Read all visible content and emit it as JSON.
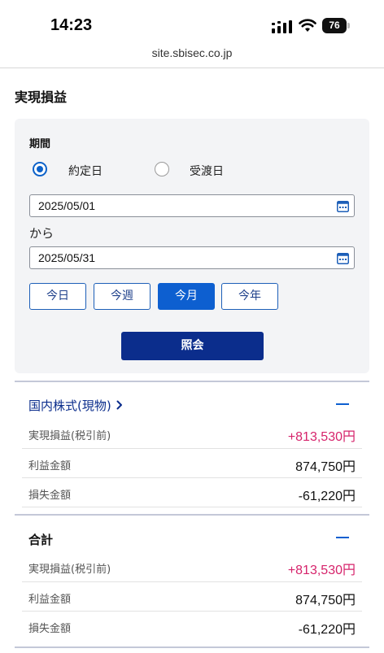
{
  "status_bar": {
    "time": "14:23",
    "battery": "76"
  },
  "browser": {
    "url": "site.sbisec.co.jp"
  },
  "page": {
    "title": "実現損益"
  },
  "filter": {
    "period_label": "期間",
    "radio_trade_date": "約定日",
    "radio_settlement_date": "受渡日",
    "selected_radio": "約定日",
    "date_from": "2025/05/01",
    "kara": "から",
    "date_to": "2025/05/31",
    "quick_buttons": [
      "今日",
      "今週",
      "今月",
      "今年"
    ],
    "active_quick_button": "今月",
    "inquiry_button": "照会"
  },
  "domestic": {
    "title": "国内株式(現物)",
    "rows": [
      {
        "label": "実現損益(税引前)",
        "value": "+813,530円"
      },
      {
        "label": "利益金額",
        "value": "874,750円"
      },
      {
        "label": "損失金額",
        "value": "-61,220円"
      }
    ]
  },
  "total": {
    "title": "合計",
    "rows": [
      {
        "label": "実現損益(税引前)",
        "value": "+813,530円"
      },
      {
        "label": "利益金額",
        "value": "874,750円"
      },
      {
        "label": "損失金額",
        "value": "-61,220円"
      }
    ]
  },
  "colors": {
    "accent": "#0b2d8c",
    "active": "#0d5fd0",
    "positive": "#d6236b",
    "panel": "#f3f4f6"
  }
}
